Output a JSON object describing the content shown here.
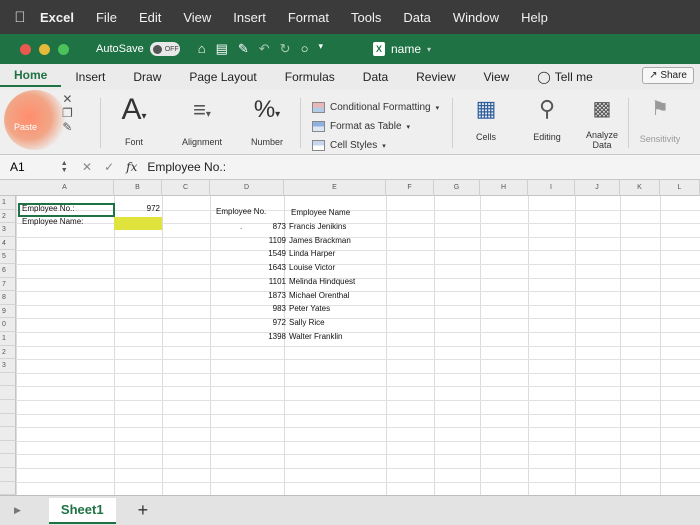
{
  "menubar": {
    "items": [
      "Excel",
      "File",
      "Edit",
      "View",
      "Insert",
      "Format",
      "Tools",
      "Data",
      "Window",
      "Help"
    ]
  },
  "titlebar": {
    "autosave_label": "AutoSave",
    "autosave_state": "OFF",
    "document_name": "name"
  },
  "tabs": {
    "items": [
      "Home",
      "Insert",
      "Draw",
      "Page Layout",
      "Formulas",
      "Data",
      "Review",
      "View"
    ],
    "active": "Home",
    "tell_me": "Tell me",
    "share": "Share"
  },
  "ribbon": {
    "paste": "Paste",
    "font": "Font",
    "alignment": "Alignment",
    "number": "Number",
    "conditional_formatting": "Conditional Formatting",
    "format_as_table": "Format as Table",
    "cell_styles": "Cell Styles",
    "cells": "Cells",
    "editing": "Editing",
    "analyze_data": "Analyze Data",
    "sensitivity": "Sensitivity"
  },
  "formula_bar": {
    "name_box": "A1",
    "fx": "fx",
    "content": "Employee No.:"
  },
  "grid": {
    "columns": [
      "A",
      "B",
      "C",
      "D",
      "E",
      "F",
      "G",
      "H",
      "I",
      "J",
      "K",
      "L"
    ],
    "rows": [
      "1",
      "2",
      "3",
      "4",
      "5",
      "6",
      "7",
      "8",
      "9",
      "0",
      "1",
      "2",
      "3"
    ],
    "a1": "Employee No.:",
    "b1": "972",
    "a2": "Employee Name:",
    "d_header": "Employee No.",
    "e_header": "Employee Name",
    "employees": [
      {
        "no": "873",
        "name": "Francis Jenikins"
      },
      {
        "no": "1109",
        "name": "James Brackman"
      },
      {
        "no": "1549",
        "name": "Linda Harper"
      },
      {
        "no": "1643",
        "name": "Louise Victor"
      },
      {
        "no": "1101",
        "name": "Melinda Hindquest"
      },
      {
        "no": "1873",
        "name": "Michael Orenthal"
      },
      {
        "no": "983",
        "name": "Peter Yates"
      },
      {
        "no": "972",
        "name": "Sally Rice"
      },
      {
        "no": "1398",
        "name": "Walter Franklin"
      }
    ],
    "highlight_color": "#dfe33b"
  },
  "sheets": {
    "tabs": [
      "Sheet1"
    ],
    "add": "+"
  },
  "colors": {
    "excel_green": "#1f7244",
    "menubar": "#3b3b3b"
  }
}
